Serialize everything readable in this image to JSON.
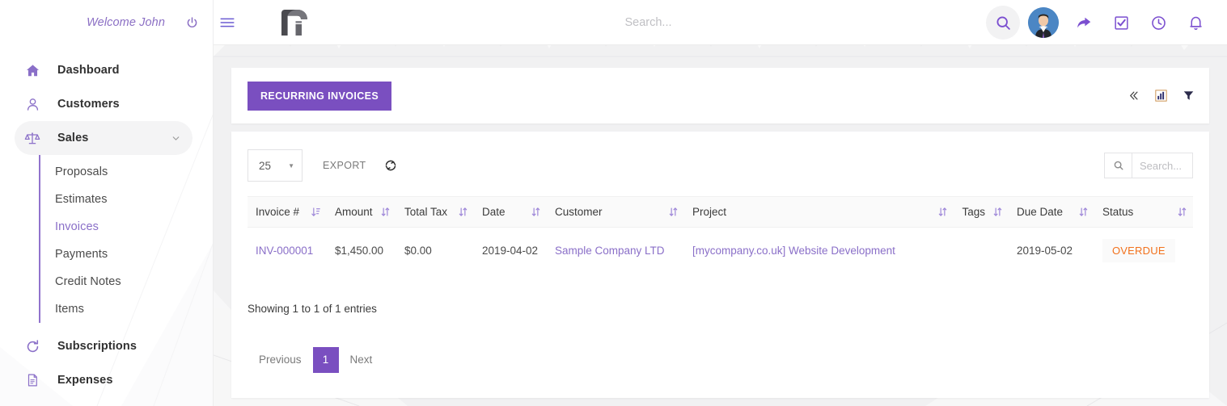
{
  "sidebar": {
    "welcome": "Welcome John",
    "power_icon": "power-icon",
    "items": [
      {
        "label": "Dashboard",
        "icon": "home-icon"
      },
      {
        "label": "Customers",
        "icon": "user-icon"
      },
      {
        "label": "Sales",
        "icon": "scales-icon",
        "active": true,
        "caret": "chevron-down-icon"
      },
      {
        "label": "Subscriptions",
        "icon": "refresh-icon"
      },
      {
        "label": "Expenses",
        "icon": "document-icon"
      }
    ],
    "subitems": [
      {
        "label": "Proposals",
        "current": false
      },
      {
        "label": "Estimates",
        "current": false
      },
      {
        "label": "Invoices",
        "current": true
      },
      {
        "label": "Payments",
        "current": false
      },
      {
        "label": "Credit Notes",
        "current": false
      },
      {
        "label": "Items",
        "current": false
      }
    ]
  },
  "topbar": {
    "menu_icon": "hamburger-icon",
    "logo": "app-logo",
    "search_placeholder": "Search...",
    "search_value": "",
    "icons": [
      {
        "name": "search-icon"
      },
      {
        "name": "avatar"
      },
      {
        "name": "share-arrow-icon"
      },
      {
        "name": "checkbox-icon"
      },
      {
        "name": "clock-icon"
      },
      {
        "name": "bell-icon"
      }
    ]
  },
  "card_header": {
    "primary_button": "RECURRING INVOICES",
    "tools": [
      {
        "name": "collapse-icon",
        "glyph": "«"
      },
      {
        "name": "chart-icon"
      },
      {
        "name": "filter-icon"
      }
    ]
  },
  "table_tools": {
    "page_length": "25",
    "export_label": "EXPORT",
    "refresh_icon": "refresh-icon",
    "search_icon": "search-icon",
    "search_placeholder": "Search...",
    "search_value": ""
  },
  "table": {
    "columns": [
      {
        "label": "Invoice #",
        "sort": "desc"
      },
      {
        "label": "Amount",
        "sort": "none"
      },
      {
        "label": "Total Tax",
        "sort": "none"
      },
      {
        "label": "Date",
        "sort": "none"
      },
      {
        "label": "Customer",
        "sort": "none"
      },
      {
        "label": "Project",
        "sort": "none"
      },
      {
        "label": "Tags",
        "sort": "none"
      },
      {
        "label": "Due Date",
        "sort": "none"
      },
      {
        "label": "Status",
        "sort": "none"
      }
    ],
    "rows": [
      {
        "invoice": "INV-000001",
        "amount": "$1,450.00",
        "total_tax": "$0.00",
        "date": "2019-04-02",
        "customer": "Sample Company LTD",
        "project": "[mycompany.co.uk] Website Development",
        "tags": "",
        "due_date": "2019-05-02",
        "status": "OVERDUE"
      }
    ]
  },
  "footer": {
    "entries_info": "Showing 1 to 1 of 1 entries",
    "previous": "Previous",
    "page": "1",
    "next": "Next"
  },
  "colors": {
    "accent": "#7a4fc0",
    "link": "#8a6fc8",
    "status_overdue": "#f2711c",
    "sidebar_bg": "#ffffff",
    "page_bg": "#f1f1f2"
  }
}
